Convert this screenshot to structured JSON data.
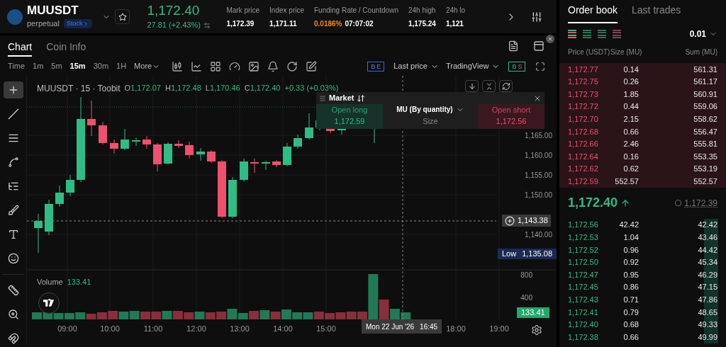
{
  "header": {
    "symbol": "MUUSDT",
    "subtitle": "perpetual",
    "badge": "Stock",
    "last_price": "1,172.40",
    "change": "27.81 (+2.43%)",
    "stats": [
      {
        "label": "Mark price",
        "value": "1,172.39"
      },
      {
        "label": "Index price",
        "value": "1,171.11"
      },
      {
        "label": "Funding Rate / Countdown",
        "rate": "0.0186%",
        "value": "07:07:02"
      },
      {
        "label": "24h high",
        "value": "1,175.24"
      },
      {
        "label": "24h lo",
        "value": "1,121"
      }
    ]
  },
  "chart_panel": {
    "tabs": [
      {
        "label": "Chart",
        "selected": true
      },
      {
        "label": "Coin Info",
        "selected": false
      }
    ],
    "intervals": [
      {
        "label": "Time",
        "selected": false
      },
      {
        "label": "1m",
        "selected": false
      },
      {
        "label": "5m",
        "selected": false
      },
      {
        "label": "15m",
        "selected": true
      },
      {
        "label": "30m",
        "selected": false
      },
      {
        "label": "1H",
        "selected": false
      }
    ],
    "more": "More",
    "be_toggle": [
      "B",
      "E"
    ],
    "price_source": "Last price",
    "view": "TradingView",
    "bs_toggle": [
      "B",
      "S"
    ],
    "tools": [
      {
        "selected": true
      },
      {
        "selected": false
      },
      {
        "selected": false
      },
      {
        "selected": false
      },
      {
        "selected": false
      },
      {
        "selected": false
      },
      {
        "selected": false
      },
      {
        "selected": false
      },
      {
        "selected": false
      },
      {
        "selected": false
      },
      {
        "selected": false
      }
    ],
    "legend": {
      "title": "MUUSDT · 15 · Toobit",
      "ohlc": [
        {
          "label": "O",
          "value": "1,172.07"
        },
        {
          "label": "H",
          "value": "1,172.48"
        },
        {
          "label": "L",
          "value": "1,170.46"
        },
        {
          "label": "C",
          "value": "1,172.40"
        }
      ],
      "change": "+0.33 (+0.03%)"
    },
    "order_panel": {
      "title": "Market",
      "long_label": "Open long",
      "long_price": "1,172.59",
      "unit": "MU (By quantity)",
      "size_label": "Size",
      "short_label": "Open short",
      "short_price": "1,172.56"
    },
    "y_axis": [
      "1,165.00",
      "1,160.00",
      "1,155.00",
      "1,150.00",
      "1,140.00"
    ],
    "crosshair_price": "1,143.38",
    "low_tag": {
      "label": "Low",
      "value": "1,135.08"
    },
    "volume": {
      "label": "Volume",
      "value": "133.41",
      "ticks": [
        "800",
        "400"
      ],
      "tag": "133.41"
    },
    "x_axis": [
      "09:00",
      "10:00",
      "11:00",
      "12:00",
      "13:00",
      "14:00",
      "15:00",
      "18:00",
      "19:00"
    ],
    "crosshair_time": {
      "date": "Mon 22 Jun '26",
      "time": "16:45"
    }
  },
  "order_book": {
    "tabs": [
      {
        "label": "Order book",
        "selected": true
      },
      {
        "label": "Last trades",
        "selected": false
      }
    ],
    "layouts": [
      {
        "selected": true
      },
      {
        "selected": false
      },
      {
        "selected": false
      },
      {
        "selected": false
      }
    ],
    "precision": "0.01",
    "columns": [
      "Price (USDT)",
      "Size (MU)",
      "Sum (MU)"
    ],
    "asks": [
      {
        "price": "1,172.77",
        "size": "0.14",
        "sum": "561.31"
      },
      {
        "price": "1,172.75",
        "size": "0.26",
        "sum": "561.17"
      },
      {
        "price": "1,172.73",
        "size": "1.85",
        "sum": "560.91"
      },
      {
        "price": "1,172.72",
        "size": "0.44",
        "sum": "559.06"
      },
      {
        "price": "1,172.70",
        "size": "2.15",
        "sum": "558.62"
      },
      {
        "price": "1,172.68",
        "size": "0.66",
        "sum": "556.47"
      },
      {
        "price": "1,172.66",
        "size": "2.46",
        "sum": "555.81"
      },
      {
        "price": "1,172.64",
        "size": "0.16",
        "sum": "553.35"
      },
      {
        "price": "1,172.62",
        "size": "0.62",
        "sum": "553.19"
      },
      {
        "price": "1,172.59",
        "size": "552.57",
        "sum": "552.57"
      }
    ],
    "last_price": "1,172.40",
    "mark_price": "1,172.39",
    "bids": [
      {
        "price": "1,172.56",
        "size": "42.42",
        "sum": "42.42"
      },
      {
        "price": "1,172.53",
        "size": "1.04",
        "sum": "43.46"
      },
      {
        "price": "1,172.52",
        "size": "0.96",
        "sum": "44.42"
      },
      {
        "price": "1,172.50",
        "size": "0.92",
        "sum": "45.34"
      },
      {
        "price": "1,172.47",
        "size": "0.95",
        "sum": "46.29"
      },
      {
        "price": "1,172.45",
        "size": "0.86",
        "sum": "47.15"
      },
      {
        "price": "1,172.43",
        "size": "0.71",
        "sum": "47.86"
      },
      {
        "price": "1,172.41",
        "size": "0.79",
        "sum": "48.65"
      },
      {
        "price": "1,172.40",
        "size": "0.68",
        "sum": "49.33"
      },
      {
        "price": "1,172.38",
        "size": "0.66",
        "sum": "49.99"
      }
    ]
  }
}
